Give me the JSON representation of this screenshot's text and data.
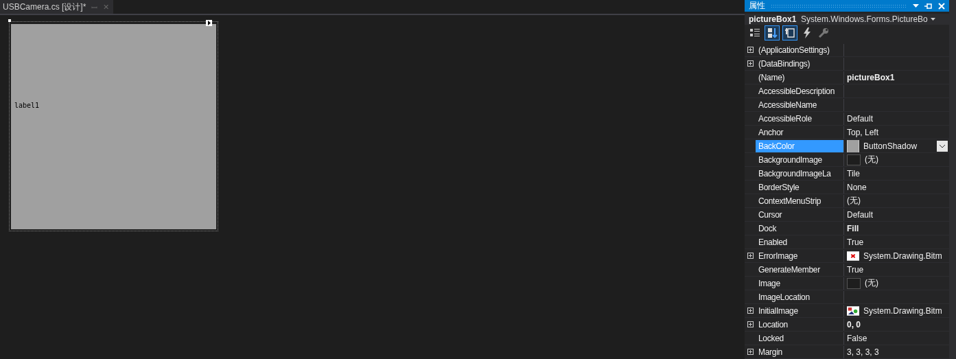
{
  "document_tab": {
    "title": "USBCamera.cs [设计]*",
    "pin": "ꟷ",
    "close": "✕"
  },
  "designer": {
    "label": "label1"
  },
  "properties_panel": {
    "title": "属性",
    "object_name": "pictureBox1",
    "object_type": "System.Windows.Forms.PictureBo",
    "properties": [
      {
        "name": "(ApplicationSettings)",
        "kind": "text",
        "expandable": true,
        "selected": false
      },
      {
        "name": "(DataBindings)",
        "kind": "text",
        "expandable": true,
        "selected": false
      },
      {
        "name": "(Name)",
        "value": "pictureBox1",
        "kind": "text",
        "expandable": false,
        "bold": true,
        "selected": false
      },
      {
        "name": "AccessibleDescription",
        "kind": "text",
        "expandable": false,
        "selected": false
      },
      {
        "name": "AccessibleName",
        "kind": "text",
        "expandable": false,
        "selected": false
      },
      {
        "name": "AccessibleRole",
        "value": "Default",
        "kind": "text",
        "expandable": false,
        "bold": false,
        "selected": false
      },
      {
        "name": "Anchor",
        "value": "Top, Left",
        "kind": "text",
        "expandable": false,
        "bold": false,
        "selected": false
      },
      {
        "name": "BackColor",
        "value": "ButtonShadow",
        "kind": "color",
        "expandable": false,
        "bold": false,
        "selected": true,
        "dropdown": true
      },
      {
        "name": "BackgroundImage",
        "value": "(无)",
        "kind": "image-empty",
        "expandable": false,
        "bold": false,
        "selected": false
      },
      {
        "name": "BackgroundImageLa",
        "value": "Tile",
        "kind": "text",
        "expandable": false,
        "bold": false,
        "selected": false
      },
      {
        "name": "BorderStyle",
        "value": "None",
        "kind": "text",
        "expandable": false,
        "bold": false,
        "selected": false
      },
      {
        "name": "ContextMenuStrip",
        "value": "(无)",
        "kind": "text",
        "expandable": false,
        "bold": false,
        "selected": false
      },
      {
        "name": "Cursor",
        "value": "Default",
        "kind": "text",
        "expandable": false,
        "bold": false,
        "selected": false
      },
      {
        "name": "Dock",
        "value": "Fill",
        "kind": "text",
        "expandable": false,
        "bold": true,
        "selected": false
      },
      {
        "name": "Enabled",
        "value": "True",
        "kind": "text",
        "expandable": false,
        "bold": false,
        "selected": false
      },
      {
        "name": "ErrorImage",
        "value": "System.Drawing.Bitm",
        "kind": "image-error",
        "expandable": true,
        "bold": false,
        "selected": false
      },
      {
        "name": "GenerateMember",
        "value": "True",
        "kind": "text",
        "expandable": false,
        "bold": false,
        "selected": false
      },
      {
        "name": "Image",
        "value": "(无)",
        "kind": "image-empty",
        "expandable": false,
        "bold": false,
        "selected": false
      },
      {
        "name": "ImageLocation",
        "kind": "text",
        "expandable": false,
        "selected": false
      },
      {
        "name": "InitialImage",
        "value": "System.Drawing.Bitm",
        "kind": "image-initial",
        "expandable": true,
        "bold": false,
        "selected": false
      },
      {
        "name": "Location",
        "value": "0, 0",
        "kind": "text",
        "expandable": true,
        "bold": true,
        "selected": false
      },
      {
        "name": "Locked",
        "value": "False",
        "kind": "text",
        "expandable": false,
        "bold": false,
        "selected": false
      },
      {
        "name": "Margin",
        "value": "3, 3, 3, 3",
        "kind": "text",
        "expandable": true,
        "bold": false,
        "selected": false
      }
    ]
  }
}
